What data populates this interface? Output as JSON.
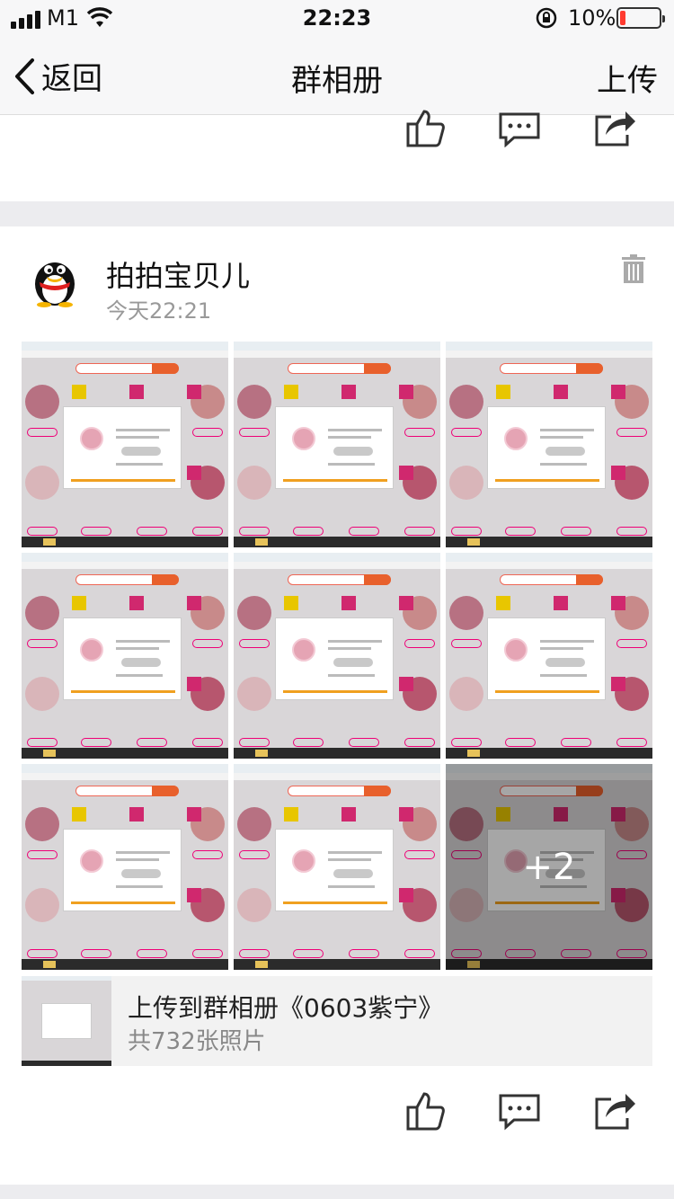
{
  "status_bar": {
    "carrier": "M1",
    "time": "22:23",
    "battery_percent": "10%",
    "battery_level": 0.1,
    "battery_color": "#ff3b30"
  },
  "nav": {
    "back_label": "返回",
    "title": "群相册",
    "upload_label": "上传"
  },
  "post": {
    "username": "拍拍宝贝儿",
    "time": "今天22:21",
    "more_count_label": "+2",
    "photos": [
      {
        "name": "photo-1"
      },
      {
        "name": "photo-2"
      },
      {
        "name": "photo-3"
      },
      {
        "name": "photo-4"
      },
      {
        "name": "photo-5"
      },
      {
        "name": "photo-6"
      },
      {
        "name": "photo-7"
      },
      {
        "name": "photo-8"
      },
      {
        "name": "photo-9"
      }
    ],
    "album": {
      "title": "上传到群相册《0603紫宁》",
      "count": "共732张照片"
    }
  },
  "icons": {
    "like": "thumbs-up-icon",
    "comment": "comment-icon",
    "share": "share-icon",
    "delete": "trash-icon",
    "back": "chevron-left-icon"
  },
  "colors": {
    "accent_tag": "#d0286e",
    "search_orange": "#e8602c",
    "separator": "#ececef"
  }
}
